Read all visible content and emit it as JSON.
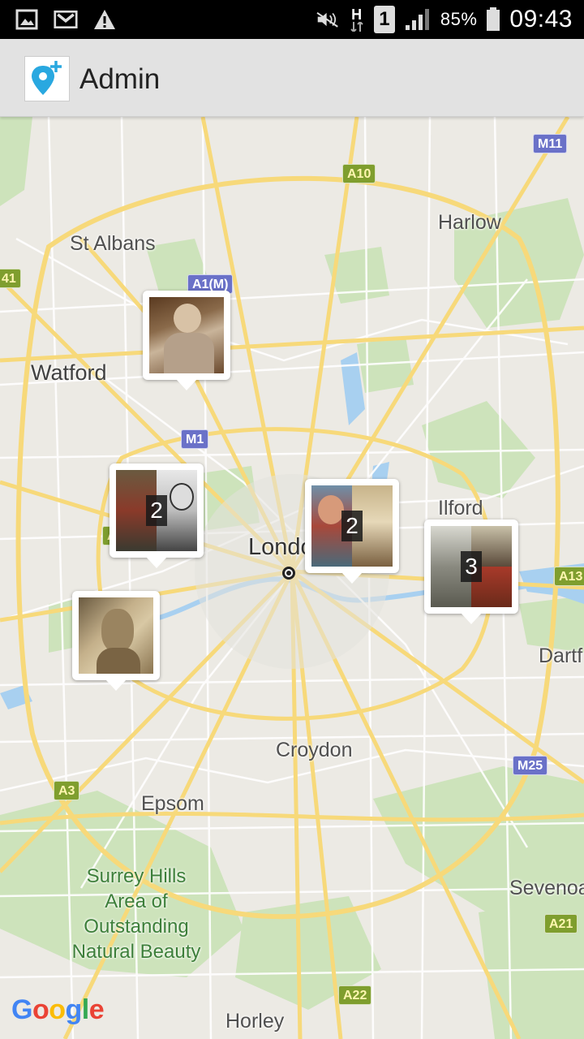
{
  "status_bar": {
    "battery": "85%",
    "time": "09:43",
    "sim": "1",
    "network": "H",
    "icons": [
      "gallery-icon",
      "gmail-icon",
      "warning-icon",
      "mute-icon",
      "data-arrows-icon",
      "sim-icon",
      "signal-icon",
      "battery-icon"
    ]
  },
  "app_bar": {
    "title": "Admin",
    "logo_icon": "map-pin-add-icon",
    "accent": "#29a8e0"
  },
  "map": {
    "places": {
      "st_albans": "St Albans",
      "harlow": "Harlow",
      "watford": "Watford",
      "ilford": "Ilford",
      "london": "London",
      "dartford": "Dartf",
      "croydon": "Croydon",
      "epsom": "Epsom",
      "surrey_hills": "Surrey Hills\nArea of\nOutstanding\nNatural Beauty",
      "sevenoaks": "Sevenoa",
      "horley": "Horley"
    },
    "roads": {
      "m11": "M11",
      "a10": "A10",
      "a41": "41",
      "a1m": "A1(M)",
      "m1": "M1",
      "a13": "A13",
      "a3": "A3",
      "m25": "M25",
      "a21": "A21",
      "a22": "A22",
      "a4": "A"
    },
    "markers": [
      {
        "label": "",
        "count": ""
      },
      {
        "label": "",
        "count": "2"
      },
      {
        "label": "",
        "count": "2"
      },
      {
        "label": "",
        "count": "3"
      },
      {
        "label": "",
        "count": ""
      }
    ],
    "attribution": "Google"
  }
}
